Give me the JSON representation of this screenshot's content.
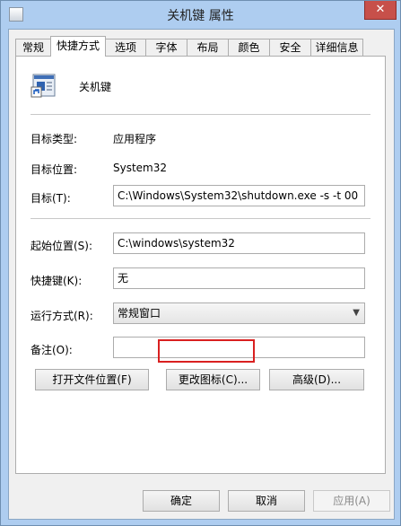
{
  "window": {
    "title": "关机键 属性",
    "close_label": "✕"
  },
  "tabs": [
    {
      "label": "常规"
    },
    {
      "label": "快捷方式"
    },
    {
      "label": "选项"
    },
    {
      "label": "字体"
    },
    {
      "label": "布局"
    },
    {
      "label": "颜色"
    },
    {
      "label": "安全"
    },
    {
      "label": "详细信息"
    }
  ],
  "shortcut": {
    "name": "关机键",
    "target_type_label": "目标类型:",
    "target_type_value": "应用程序",
    "target_location_label": "目标位置:",
    "target_location_value": "System32",
    "target_label": "目标(T):",
    "target_value": "C:\\Windows\\System32\\shutdown.exe -s -t 00",
    "start_in_label": "起始位置(S):",
    "start_in_value": "C:\\windows\\system32",
    "shortcut_key_label": "快捷键(K):",
    "shortcut_key_value": "无",
    "run_label": "运行方式(R):",
    "run_value": "常规窗口",
    "comment_label": "备注(O):",
    "comment_value": "",
    "open_location_button": "打开文件位置(F)",
    "change_icon_button": "更改图标(C)...",
    "advanced_button": "高级(D)..."
  },
  "footer": {
    "ok": "确定",
    "cancel": "取消",
    "apply": "应用(A)"
  },
  "colors": {
    "highlight": "#d92020",
    "title_bar": "#aecdf0"
  }
}
